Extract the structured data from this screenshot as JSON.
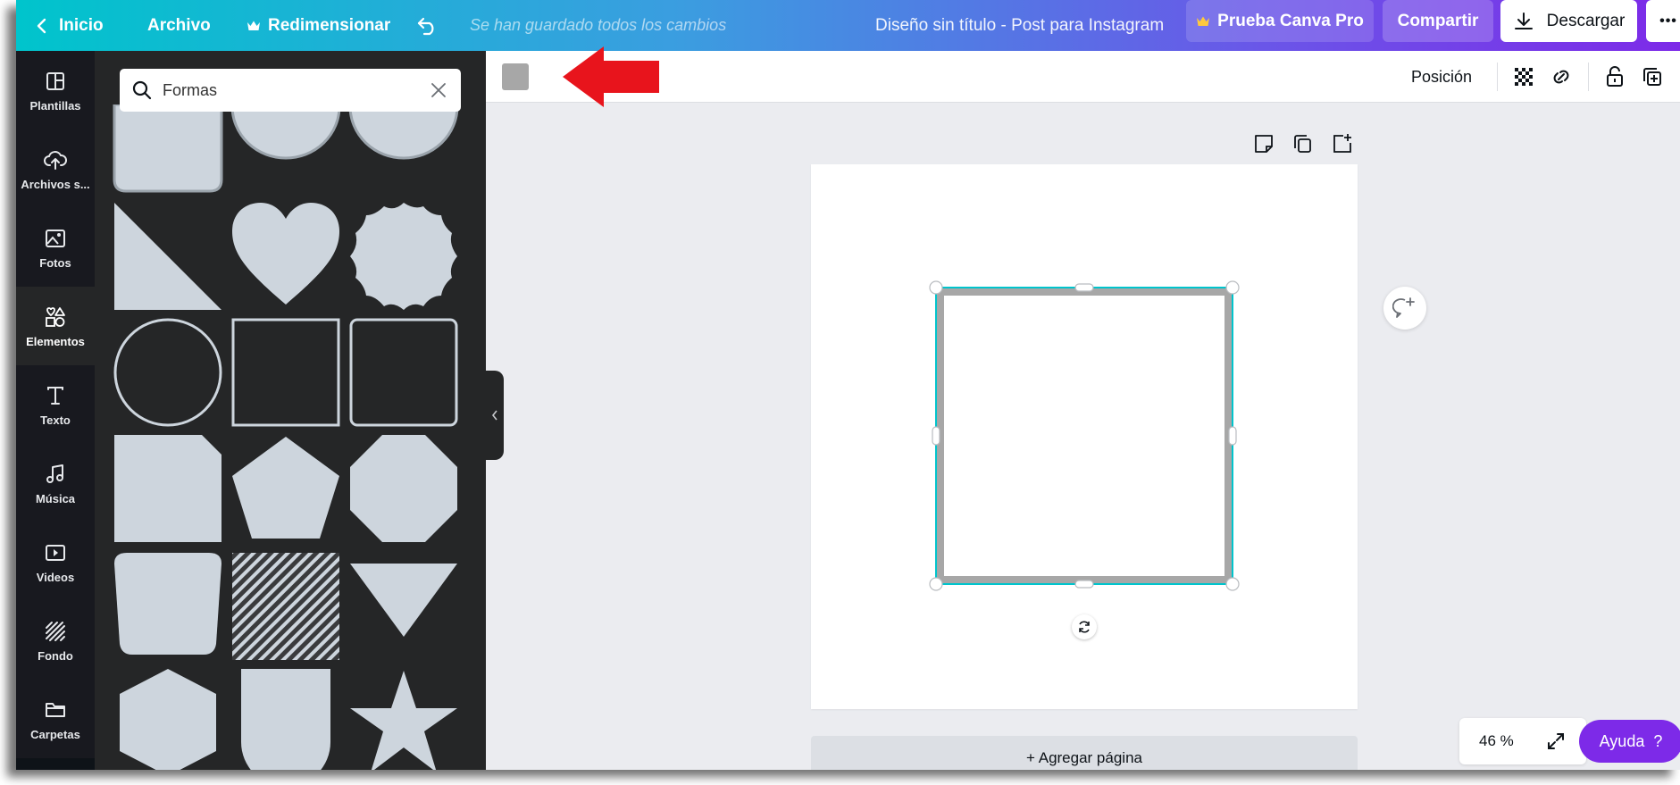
{
  "topbar": {
    "home_label": "Inicio",
    "file_label": "Archivo",
    "resize_label": "Redimensionar",
    "save_status": "Se han guardado todos los cambios",
    "design_title": "Diseño sin título - Post para Instagram",
    "pro_label": "Prueba Canva Pro",
    "share_label": "Compartir",
    "download_label": "Descargar",
    "more_label": "•••"
  },
  "rail": {
    "items": [
      {
        "label": "Plantillas",
        "icon": "layout-icon"
      },
      {
        "label": "Archivos s...",
        "icon": "cloud-upload-icon"
      },
      {
        "label": "Fotos",
        "icon": "image-icon"
      },
      {
        "label": "Elementos",
        "icon": "shapes-icon"
      },
      {
        "label": "Texto",
        "icon": "text-icon"
      },
      {
        "label": "Música",
        "icon": "music-icon"
      },
      {
        "label": "Videos",
        "icon": "video-icon"
      },
      {
        "label": "Fondo",
        "icon": "background-icon"
      },
      {
        "label": "Carpetas",
        "icon": "folder-icon"
      }
    ],
    "active": "Elementos"
  },
  "panel": {
    "search_value": "Formas"
  },
  "editbar": {
    "shape_color": "#a7a7a7",
    "position_label": "Posición"
  },
  "canvas": {
    "add_page_label": "+ Agregar página",
    "selection_color": "#00c4cc",
    "shape_border_color": "#a7a7a7"
  },
  "footer": {
    "zoom_label": "46 %",
    "help_label": "Ayuda  ?"
  },
  "colors": {
    "accent": "#7d2ae8",
    "panel_bg": "#252627",
    "rail_bg": "#18191f",
    "shape_fill": "#cdd5dd",
    "annotation_arrow": "#e8141c"
  }
}
